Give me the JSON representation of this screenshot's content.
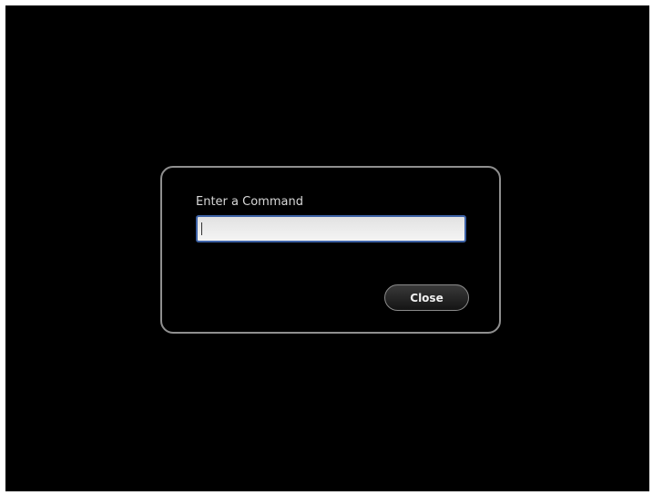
{
  "run_dialog": {
    "prompt_label": "Enter a Command",
    "input_value": "",
    "close_label": "Close"
  },
  "colors": {
    "background": "#000000",
    "dialog_border": "#8f8f8f",
    "input_focus_border": "#3d62a6",
    "label_text": "#d8d8d8"
  }
}
